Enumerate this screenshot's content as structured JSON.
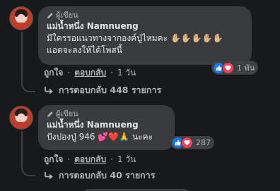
{
  "comments": [
    {
      "badge": "ผู้เขียน",
      "author": "แม่น้ำหนึ่ง Namnueng",
      "lines": [
        "มีใครรอแนวทางจากองค์ปู่ไหมคะ ✋🏼✋🏼✋🏼✋🏼✋🏼",
        "แอดจะลงให้ได้โพสนี้"
      ],
      "reaction_count": "1 พัน",
      "like_label": "ถูกใจ",
      "reply_label": "ตอบกลับ",
      "time": "1 วัน",
      "replies_label": "การตอบกลับ 448 รายการ"
    },
    {
      "badge": "ผู้เขียน",
      "author": "แม่น้ำหนึ่ง Namnueng",
      "lines": [
        "ปังปองปู่ 946 💕❤️🙏 นะคะ"
      ],
      "reaction_count": "287",
      "like_label": "ถูกใจ",
      "reply_label": "ตอบกลับ",
      "time": "1 วัน",
      "replies_label": "การตอบกลับ 40 รายการ"
    }
  ],
  "separator": "·",
  "icons": {
    "badge": "pencil-icon",
    "reactions": [
      "like-reaction-icon",
      "love-reaction-icon"
    ],
    "replies": "reply-arrow-icon"
  },
  "colors": {
    "background": "#18191a",
    "bubble": "#3a3b3c",
    "text": "#e4e6eb",
    "secondary": "#b0b3b8",
    "like": "#1877f2",
    "love": "#f33e58"
  }
}
